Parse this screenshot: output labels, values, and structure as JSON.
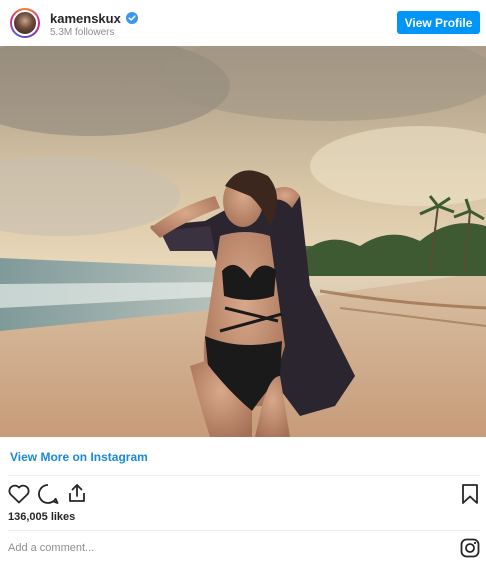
{
  "header": {
    "username": "kamenskux",
    "followers": "5.3M followers",
    "verified_icon": "verified-badge-icon",
    "view_profile_label": "View Profile"
  },
  "post": {
    "view_more_label": "View More on Instagram",
    "likes": "136,005 likes",
    "comment_placeholder": "Add a comment..."
  },
  "icons": {
    "like": "heart-icon",
    "comment": "comment-icon",
    "share": "share-icon",
    "save": "bookmark-icon",
    "instagram": "instagram-logo-icon"
  },
  "colors": {
    "accent": "#0095f6",
    "link": "#1a8ad8",
    "muted": "#8e8e8e",
    "text": "#262626"
  }
}
